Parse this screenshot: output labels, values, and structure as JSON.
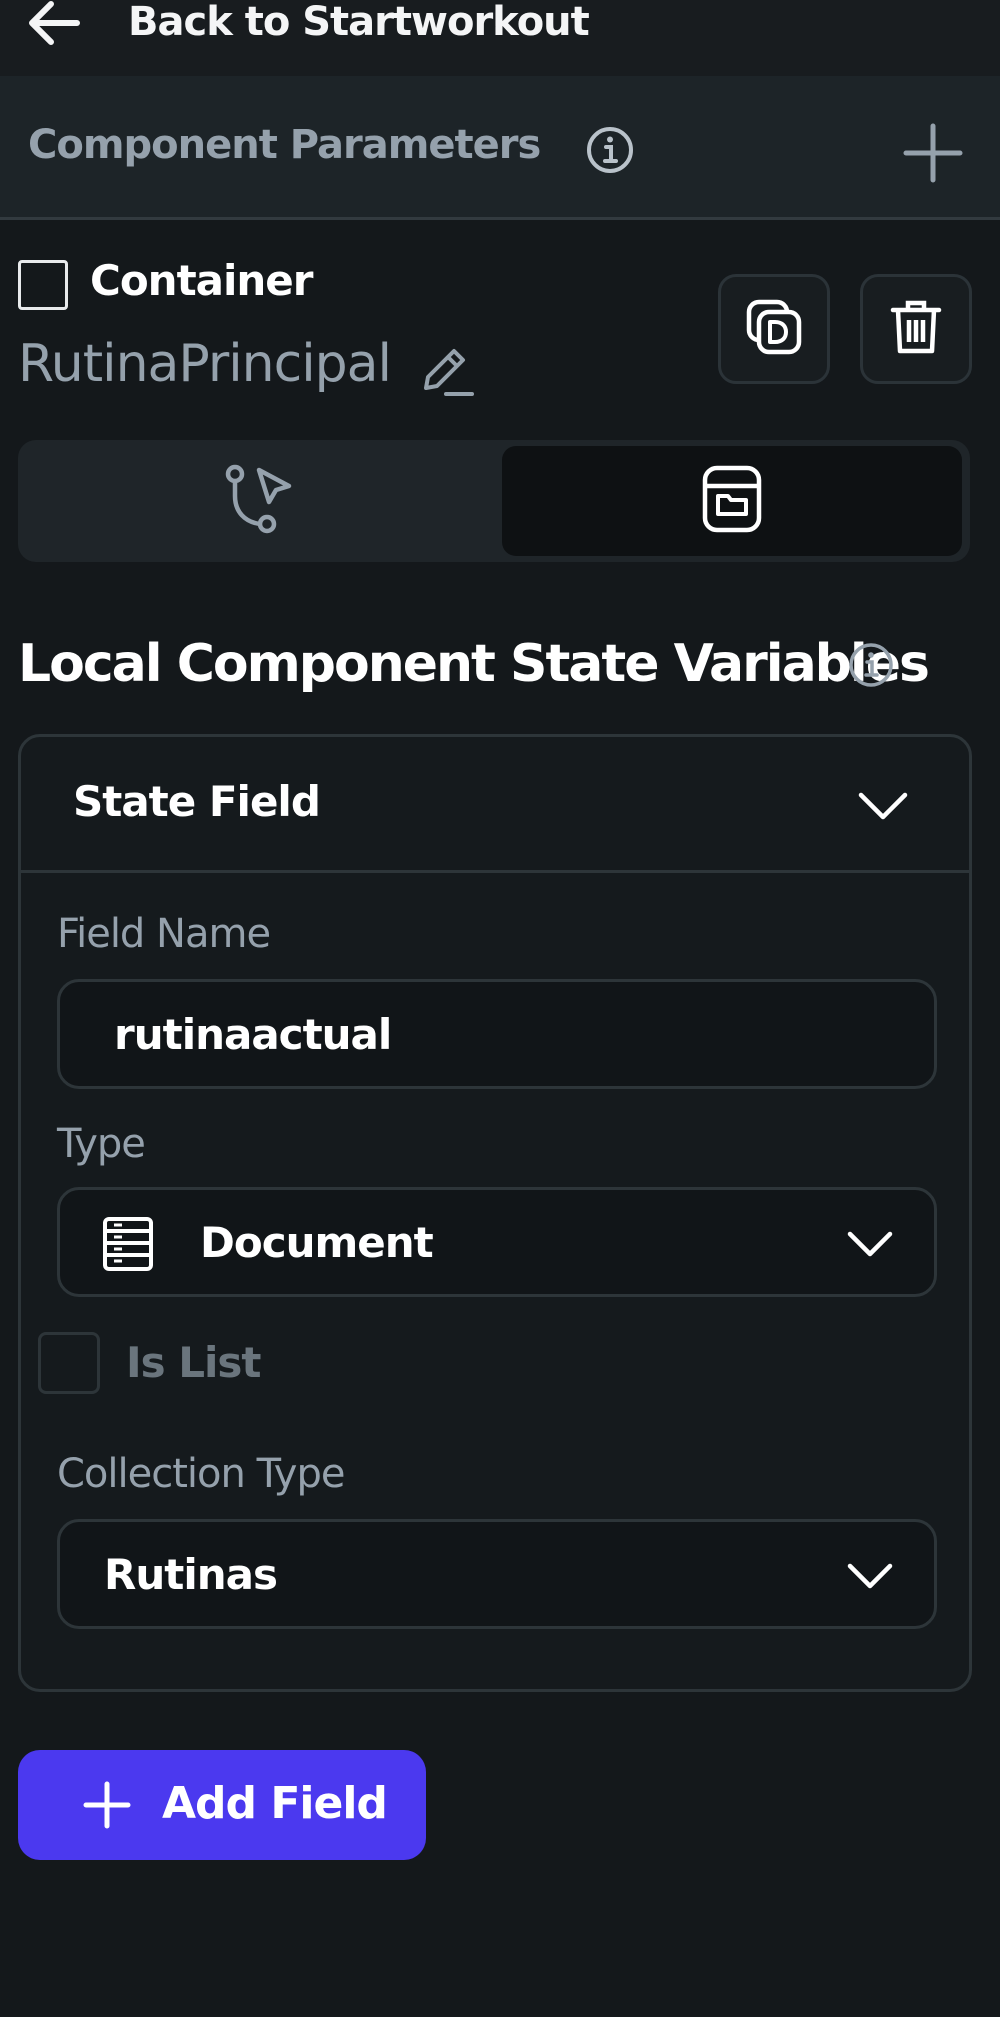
{
  "topbar": {
    "back_label": "Back to Startworkout",
    "back_icon": "arrow-left-icon"
  },
  "parameters": {
    "title": "Component Parameters",
    "info_icon": "info-icon",
    "add_icon": "plus-icon"
  },
  "widget": {
    "type_label": "Container",
    "name": "RutinaPrincipal",
    "edit_icon": "pencil-icon",
    "duplicate_icon": "duplicate-icon",
    "delete_icon": "trash-icon"
  },
  "tabs": [
    {
      "icon": "actions-flow-icon",
      "active": false
    },
    {
      "icon": "state-variables-icon",
      "active": true
    }
  ],
  "state_section": {
    "title": "Local Component State Variables",
    "info_icon": "info-icon"
  },
  "state_field": {
    "header": "State Field",
    "field_name_label": "Field Name",
    "field_name_value": "rutinaactual",
    "type_label": "Type",
    "type_value": "Document",
    "type_icon": "document-table-icon",
    "is_list_label": "Is List",
    "is_list_checked": false,
    "collection_type_label": "Collection Type",
    "collection_type_value": "Rutinas"
  },
  "add_field": {
    "label": "Add Field",
    "icon": "plus-icon"
  },
  "colors": {
    "background": "#14181b",
    "accent": "#4b39ef",
    "secondary_text": "#95a1ac",
    "border": "#2d3539"
  }
}
